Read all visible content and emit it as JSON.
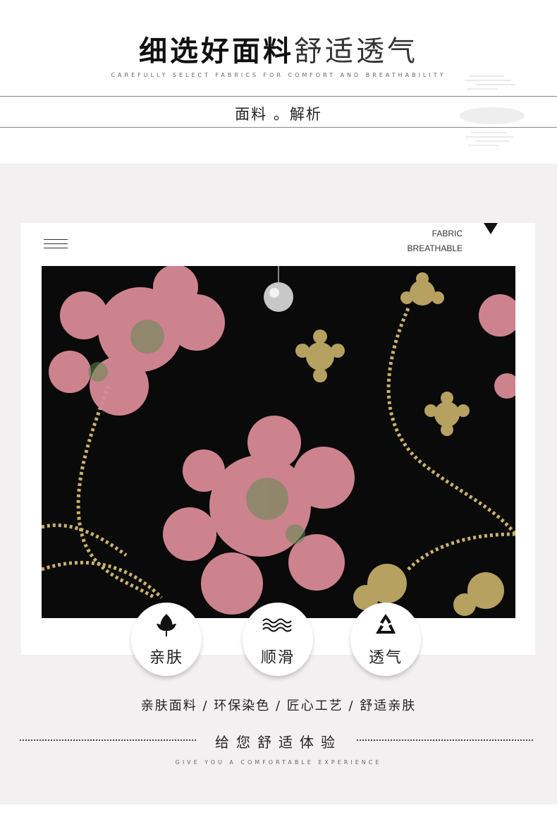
{
  "header": {
    "title_bold": "细选好面料",
    "title_light": "舒适透气",
    "subtitle_en": "CAREFULLY SELECT FABRICS FOR COMFORT AND BREATHABILITY",
    "section_label": "面料 。解析"
  },
  "card": {
    "fabric_label": "FABRIC",
    "breathable_label": "BREATHABLE"
  },
  "features": [
    {
      "icon": "leaf-icon",
      "label": "亲肤"
    },
    {
      "icon": "waves-icon",
      "label": "顺滑"
    },
    {
      "icon": "recycle-icon",
      "label": "透气"
    }
  ],
  "footer": {
    "tagline": "亲肤面料 /  环保染色 /  匠心工艺 /    舒适亲肤",
    "slogan": "给您舒适体验",
    "slogan_en": "GIVE YOU A COMFORTABLE EXPERIENCE"
  },
  "colors": {
    "panel_background": "#f3f0f1",
    "photo_background": "#0a0a0a",
    "sequin_pink": "#d88a96",
    "sequin_gold": "#c9b26a"
  }
}
